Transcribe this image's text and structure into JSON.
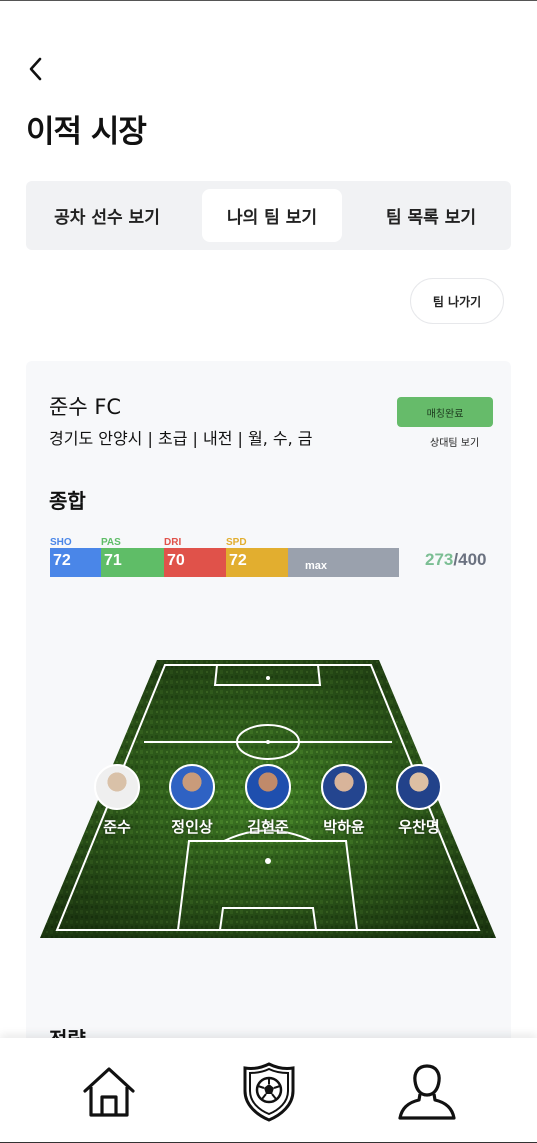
{
  "header": {
    "back_icon": "chevron-left-icon",
    "title": "이적 시장"
  },
  "tabs": [
    {
      "label": "공차 선수 보기",
      "active": false
    },
    {
      "label": "나의 팀 보기",
      "active": true
    },
    {
      "label": "팀 목록 보기",
      "active": false
    }
  ],
  "actions": {
    "leave_team": "팀 나가기"
  },
  "team": {
    "name": "준수 FC",
    "info": "경기도 안양시 | 초급 | 내전 | 월, 수, 금",
    "match_status": "매칭완료",
    "opponent_link": "상대팀 보기"
  },
  "overall": {
    "title": "종합",
    "stats": [
      {
        "key": "SHO",
        "value": "72",
        "color": "#4a86e8"
      },
      {
        "key": "PAS",
        "value": "71",
        "color": "#5fbd67"
      },
      {
        "key": "DRI",
        "value": "70",
        "color": "#e0524a"
      },
      {
        "key": "SPD",
        "value": "72",
        "color": "#e2ae2f"
      }
    ],
    "max_label": "max",
    "total": "273",
    "total_sep": "/",
    "total_max": "400"
  },
  "formation": {
    "players": [
      {
        "name": "준수"
      },
      {
        "name": "정인상"
      },
      {
        "name": "김현준"
      },
      {
        "name": "박하윤"
      },
      {
        "name": "우찬명"
      }
    ]
  },
  "strategy": {
    "title": "전략"
  },
  "bottom_nav": {
    "items": [
      {
        "icon": "home-icon"
      },
      {
        "icon": "team-crest-icon"
      },
      {
        "icon": "profile-icon"
      }
    ]
  },
  "colors": {
    "accent_green": "#66bb6a",
    "total_current": "#7bbe93",
    "tab_bg": "#f1f2f4"
  }
}
